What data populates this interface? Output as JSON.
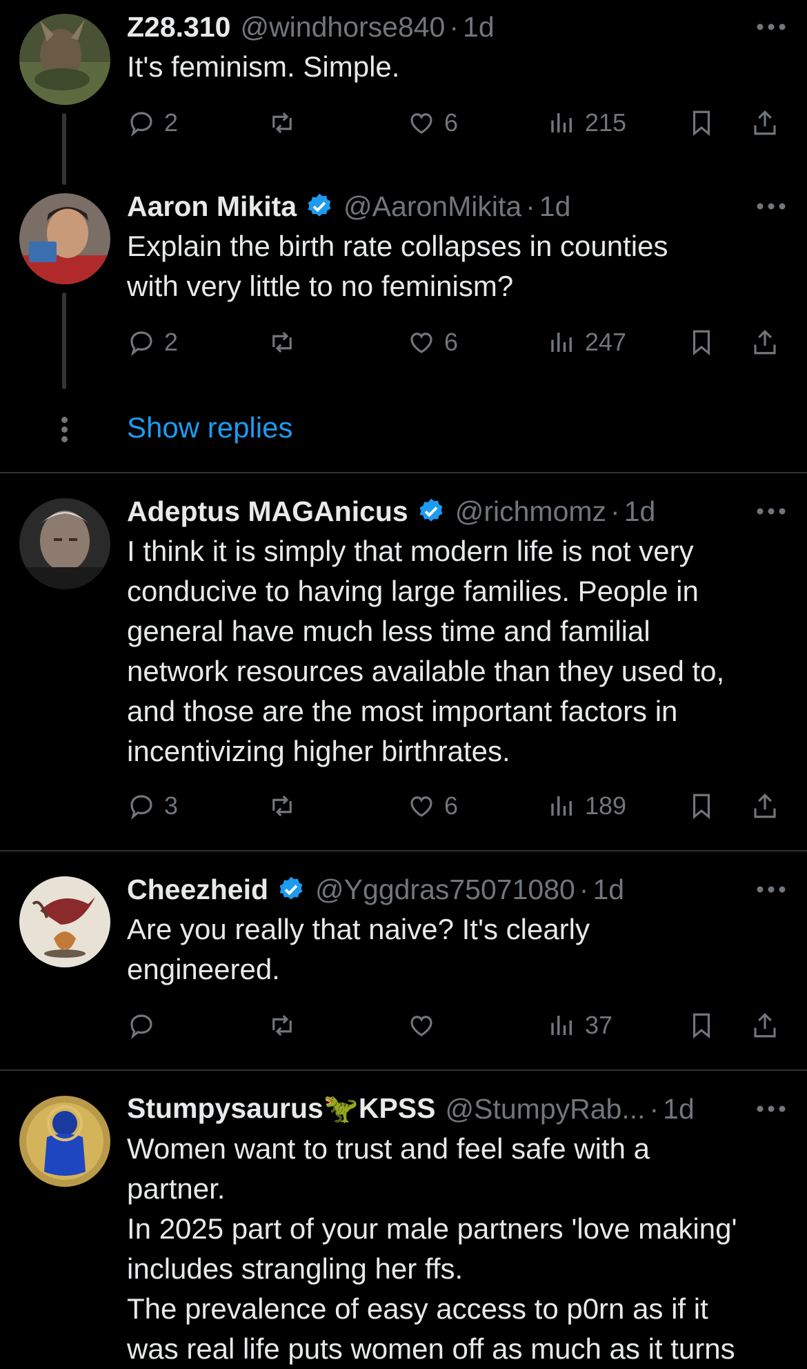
{
  "tweets": [
    {
      "name": "Z28.310",
      "verified": false,
      "handle": "@windhorse840",
      "sep": "·",
      "time": "1d",
      "text": "It's feminism. Simple.",
      "replies": "2",
      "reposts": "",
      "likes": "6",
      "views": "215"
    },
    {
      "name": "Aaron Mikita",
      "verified": true,
      "handle": "@AaronMikita",
      "sep": "·",
      "time": "1d",
      "text": "Explain the birth rate collapses in counties\nwith very little to no feminism?",
      "replies": "2",
      "reposts": "",
      "likes": "6",
      "views": "247"
    },
    {
      "name": "Adeptus MAGAnicus",
      "verified": true,
      "handle": "@richmomz",
      "sep": "·",
      "time": "1d",
      "text": "I think it is simply that modern life is not very\nconducive to having large families.  People in\ngeneral have much less time and familial\nnetwork resources available than they used to,\nand those are the most important factors in\nincentivizing higher birthrates.",
      "replies": "3",
      "reposts": "",
      "likes": "6",
      "views": "189"
    },
    {
      "name": "Cheezheid",
      "verified": true,
      "handle": "@Yggdras75071080",
      "sep": "·",
      "time": "1d",
      "text": "Are you really that naive? It's clearly\nengineered.",
      "replies": "",
      "reposts": "",
      "likes": "",
      "views": "37"
    },
    {
      "name": "Stumpysaurus🦖KPSS",
      "verified": false,
      "handle": "@StumpyRab...",
      "sep": "·",
      "time": "1d",
      "text": "Women want to trust and feel safe with a\npartner.\nIn 2025 part of your male partners 'love making'\nincludes strangling her ffs.\nThe prevalence of easy access to p0rn as if it\nwas real life puts women off as much as it turns",
      "replies": "",
      "reposts": "",
      "likes": "",
      "views": ""
    }
  ],
  "show_replies": "Show replies",
  "colors": {
    "background": "#000000",
    "text": "#e7e9ea",
    "muted": "#71767b",
    "accent": "#1d9bf0",
    "divider": "#2f3336"
  },
  "icons": [
    "reply-icon",
    "repost-icon",
    "like-icon",
    "views-icon",
    "bookmark-icon",
    "share-icon",
    "more-icon",
    "verified-badge-icon"
  ]
}
